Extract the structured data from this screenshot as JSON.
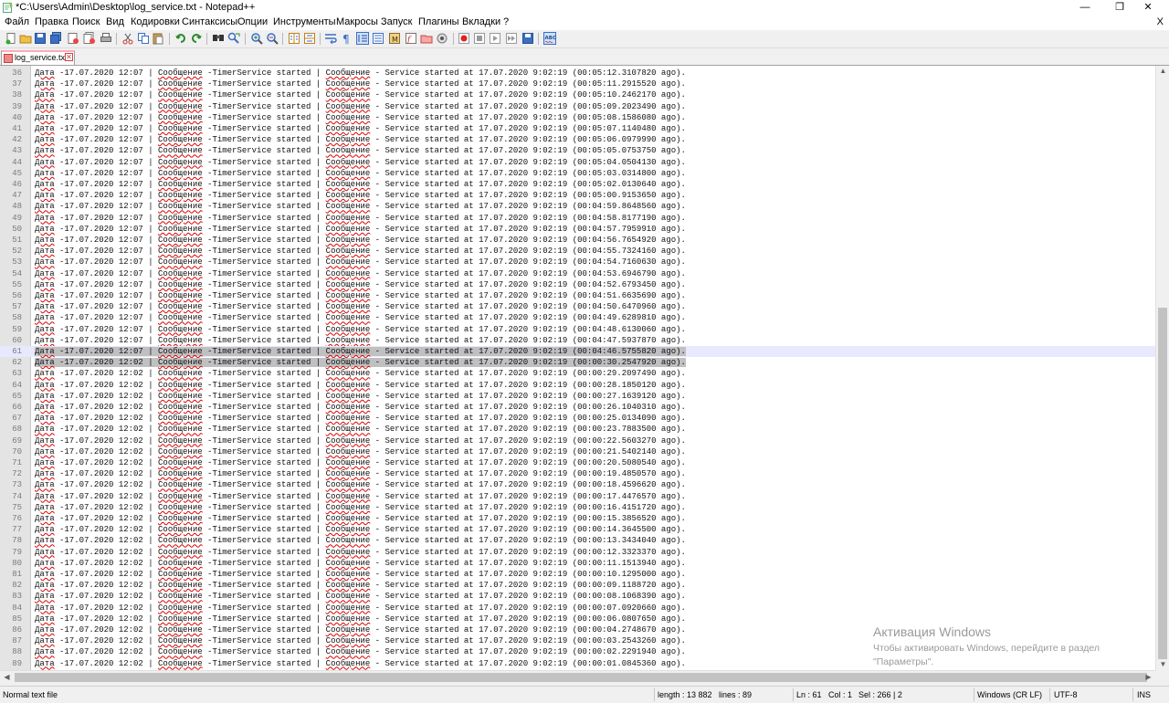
{
  "window": {
    "title": "*C:\\Users\\Admin\\Desktop\\log_service.txt - Notepad++",
    "minimize": "—",
    "maximize": "❐",
    "close": "✕"
  },
  "menu": [
    "Файл",
    "Правка",
    "Поиск",
    "Вид",
    "Кодировки",
    "Синтаксисы",
    "Опции",
    "Инструменты",
    "Макросы",
    "Запуск",
    "Плагины",
    "Вкладки",
    "?"
  ],
  "menu_close": "X",
  "toolbar": {
    "icons": [
      "new-file-icon",
      "open-file-icon",
      "save-icon",
      "save-all-icon",
      "close-icon",
      "close-all-icon",
      "print-icon",
      "cut-icon",
      "copy-icon",
      "paste-icon",
      "undo-icon",
      "redo-icon",
      "find-icon",
      "replace-icon",
      "zoom-in-icon",
      "zoom-out-icon",
      "sync-vertical-icon",
      "sync-horizontal-icon",
      "word-wrap-icon",
      "show-all-chars-icon",
      "indent-guide-icon",
      "language-icon",
      "document-map-icon",
      "function-list-icon",
      "folder-workspace-icon",
      "monitor-icon",
      "record-macro-icon",
      "stop-record-icon",
      "play-macro-icon",
      "run-macro-multiple-icon",
      "save-macro-icon",
      "spell-check-icon"
    ]
  },
  "tab": {
    "label": "log_service.txt"
  },
  "editor": {
    "current_line": 61,
    "selected_lines": [
      61,
      62
    ],
    "line_template": {
      "label_date": "Дата",
      "label_message": "Сообщение",
      "service_text": "-TimerService started",
      "started_prefix": "- Service started at 17.07.2020 9:02:19"
    },
    "lines": [
      {
        "n": 36,
        "date": "17.07.2020 12:07",
        "elapsed": "00:05:12.3107820"
      },
      {
        "n": 37,
        "date": "17.07.2020 12:07",
        "elapsed": "00:05:11.2915520"
      },
      {
        "n": 38,
        "date": "17.07.2020 12:07",
        "elapsed": "00:05:10.2462170"
      },
      {
        "n": 39,
        "date": "17.07.2020 12:07",
        "elapsed": "00:05:09.2023490"
      },
      {
        "n": 40,
        "date": "17.07.2020 12:07",
        "elapsed": "00:05:08.1586080"
      },
      {
        "n": 41,
        "date": "17.07.2020 12:07",
        "elapsed": "00:05:07.1140480"
      },
      {
        "n": 42,
        "date": "17.07.2020 12:07",
        "elapsed": "00:05:06.0979990"
      },
      {
        "n": 43,
        "date": "17.07.2020 12:07",
        "elapsed": "00:05:05.0753750"
      },
      {
        "n": 44,
        "date": "17.07.2020 12:07",
        "elapsed": "00:05:04.0504130"
      },
      {
        "n": 45,
        "date": "17.07.2020 12:07",
        "elapsed": "00:05:03.0314800"
      },
      {
        "n": 46,
        "date": "17.07.2020 12:07",
        "elapsed": "00:05:02.0130640"
      },
      {
        "n": 47,
        "date": "17.07.2020 12:07",
        "elapsed": "00:05:00.9153650"
      },
      {
        "n": 48,
        "date": "17.07.2020 12:07",
        "elapsed": "00:04:59.8648560"
      },
      {
        "n": 49,
        "date": "17.07.2020 12:07",
        "elapsed": "00:04:58.8177190"
      },
      {
        "n": 50,
        "date": "17.07.2020 12:07",
        "elapsed": "00:04:57.7959910"
      },
      {
        "n": 51,
        "date": "17.07.2020 12:07",
        "elapsed": "00:04:56.7654920"
      },
      {
        "n": 52,
        "date": "17.07.2020 12:07",
        "elapsed": "00:04:55.7324160"
      },
      {
        "n": 53,
        "date": "17.07.2020 12:07",
        "elapsed": "00:04:54.7160630"
      },
      {
        "n": 54,
        "date": "17.07.2020 12:07",
        "elapsed": "00:04:53.6946790"
      },
      {
        "n": 55,
        "date": "17.07.2020 12:07",
        "elapsed": "00:04:52.6793450"
      },
      {
        "n": 56,
        "date": "17.07.2020 12:07",
        "elapsed": "00:04:51.6635690"
      },
      {
        "n": 57,
        "date": "17.07.2020 12:07",
        "elapsed": "00:04:50.6470960"
      },
      {
        "n": 58,
        "date": "17.07.2020 12:07",
        "elapsed": "00:04:49.6289810"
      },
      {
        "n": 59,
        "date": "17.07.2020 12:07",
        "elapsed": "00:04:48.6130060"
      },
      {
        "n": 60,
        "date": "17.07.2020 12:07",
        "elapsed": "00:04:47.5937870"
      },
      {
        "n": 61,
        "date": "17.07.2020 12:07",
        "elapsed": "00:04:46.5755820"
      },
      {
        "n": 62,
        "date": "17.07.2020 12:02",
        "elapsed": "00:00:30.2547920"
      },
      {
        "n": 63,
        "date": "17.07.2020 12:02",
        "elapsed": "00:00:29.2097490"
      },
      {
        "n": 64,
        "date": "17.07.2020 12:02",
        "elapsed": "00:00:28.1850120"
      },
      {
        "n": 65,
        "date": "17.07.2020 12:02",
        "elapsed": "00:00:27.1639120"
      },
      {
        "n": 66,
        "date": "17.07.2020 12:02",
        "elapsed": "00:00:26.1040310"
      },
      {
        "n": 67,
        "date": "17.07.2020 12:02",
        "elapsed": "00:00:25.0134090"
      },
      {
        "n": 68,
        "date": "17.07.2020 12:02",
        "elapsed": "00:00:23.7883500"
      },
      {
        "n": 69,
        "date": "17.07.2020 12:02",
        "elapsed": "00:00:22.5603270"
      },
      {
        "n": 70,
        "date": "17.07.2020 12:02",
        "elapsed": "00:00:21.5402140"
      },
      {
        "n": 71,
        "date": "17.07.2020 12:02",
        "elapsed": "00:00:20.5080540"
      },
      {
        "n": 72,
        "date": "17.07.2020 12:02",
        "elapsed": "00:00:19.4850570"
      },
      {
        "n": 73,
        "date": "17.07.2020 12:02",
        "elapsed": "00:00:18.4596620"
      },
      {
        "n": 74,
        "date": "17.07.2020 12:02",
        "elapsed": "00:00:17.4476570"
      },
      {
        "n": 75,
        "date": "17.07.2020 12:02",
        "elapsed": "00:00:16.4151720"
      },
      {
        "n": 76,
        "date": "17.07.2020 12:02",
        "elapsed": "00:00:15.3856520"
      },
      {
        "n": 77,
        "date": "17.07.2020 12:02",
        "elapsed": "00:00:14.3645500"
      },
      {
        "n": 78,
        "date": "17.07.2020 12:02",
        "elapsed": "00:00:13.3434040"
      },
      {
        "n": 79,
        "date": "17.07.2020 12:02",
        "elapsed": "00:00:12.3323370"
      },
      {
        "n": 80,
        "date": "17.07.2020 12:02",
        "elapsed": "00:00:11.1513940"
      },
      {
        "n": 81,
        "date": "17.07.2020 12:02",
        "elapsed": "00:00:10.1295000"
      },
      {
        "n": 82,
        "date": "17.07.2020 12:02",
        "elapsed": "00:00:09.1188720"
      },
      {
        "n": 83,
        "date": "17.07.2020 12:02",
        "elapsed": "00:00:08.1068390"
      },
      {
        "n": 84,
        "date": "17.07.2020 12:02",
        "elapsed": "00:00:07.0920660"
      },
      {
        "n": 85,
        "date": "17.07.2020 12:02",
        "elapsed": "00:00:06.0807650"
      },
      {
        "n": 86,
        "date": "17.07.2020 12:02",
        "elapsed": "00:00:04.2748670"
      },
      {
        "n": 87,
        "date": "17.07.2020 12:02",
        "elapsed": "00:00:03.2543260"
      },
      {
        "n": 88,
        "date": "17.07.2020 12:02",
        "elapsed": "00:00:02.2291940"
      },
      {
        "n": 89,
        "date": "17.07.2020 12:02",
        "elapsed": "00:00:01.0845360"
      }
    ]
  },
  "status": {
    "file_type": "Normal text file",
    "length": "length : 13 882",
    "lines": "lines : 89",
    "ln": "Ln : 61",
    "col": "Col : 1",
    "sel": "Sel : 266 | 2",
    "eol": "Windows (CR LF)",
    "encoding": "UTF-8",
    "mode": "INS"
  },
  "watermark": {
    "title": "Активация Windows",
    "text": "Чтобы активировать Windows, перейдите в раздел \"Параметры\"."
  },
  "colors": {
    "gutter": "#e4e4e4",
    "current_line": "#e8e8ff",
    "selection": "#c0c0c0",
    "spell_underline": "#dd0000"
  }
}
